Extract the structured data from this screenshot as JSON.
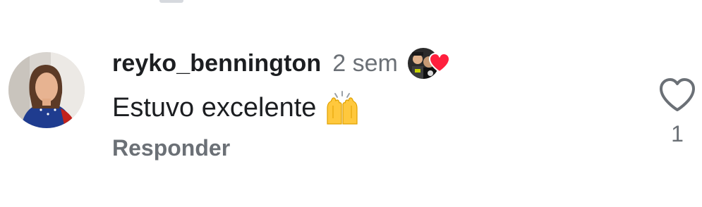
{
  "comment": {
    "username": "reyko_bennington",
    "time_ago": "2 sem",
    "text": "Estuvo excelente",
    "reaction_icon": "raising-hands-emoji",
    "reply_label": "Responder",
    "like_count": "1",
    "liked_by_creator": true
  },
  "colors": {
    "text_primary": "#1c1e21",
    "text_secondary": "#6b7076",
    "heart_red": "#ff1f3d",
    "emoji_yellow": "#ffc83d"
  }
}
